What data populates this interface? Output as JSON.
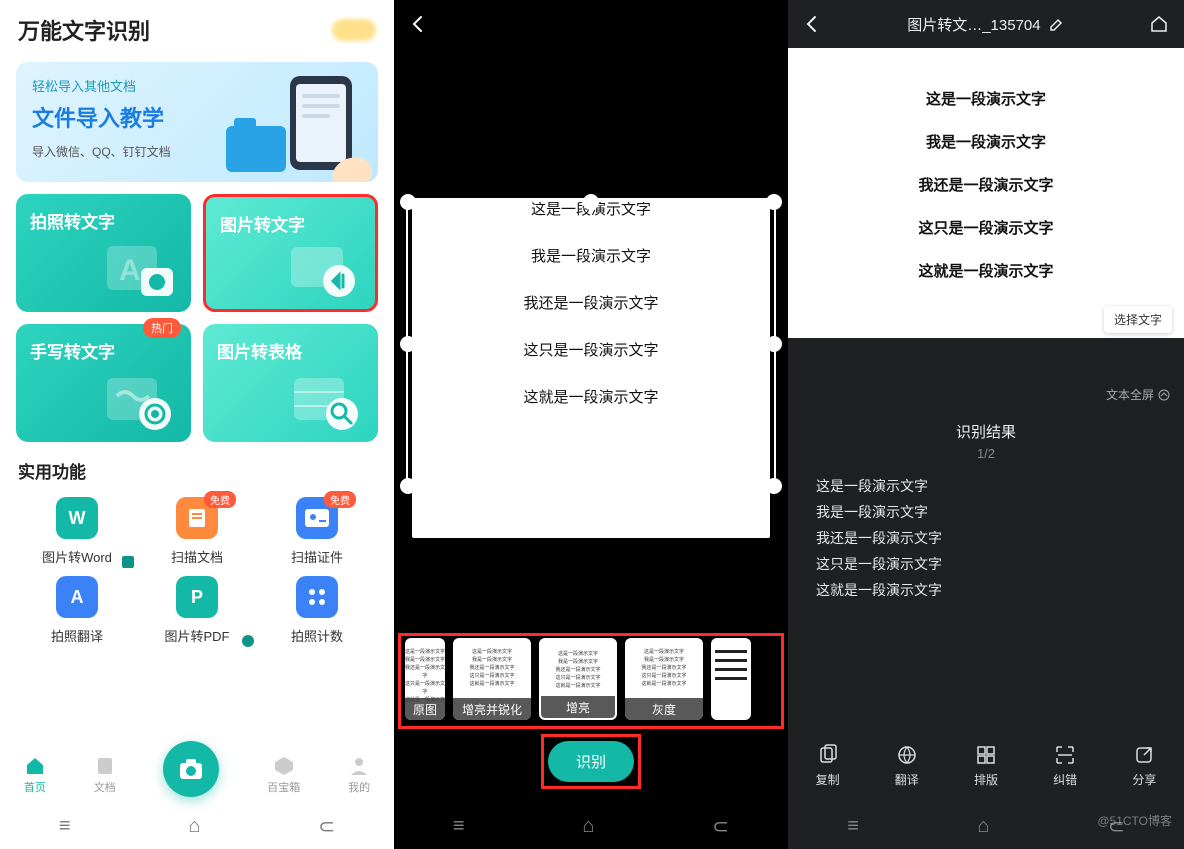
{
  "panel1": {
    "title": "万能文字识别",
    "banner": {
      "sub1": "轻松导入其他文档",
      "main": "文件导入教学",
      "sub2": "导入微信、QQ、钉钉文档"
    },
    "cards": [
      {
        "label": "拍照转文字"
      },
      {
        "label": "图片转文字"
      },
      {
        "label": "手写转文字",
        "hot": "热门"
      },
      {
        "label": "图片转表格"
      }
    ],
    "section_title": "实用功能",
    "tools": [
      {
        "label": "图片转Word",
        "color": "#14b8a6",
        "letter": "W",
        "free": ""
      },
      {
        "label": "扫描文档",
        "color": "#ff8a3d",
        "letter": "",
        "free": "免费"
      },
      {
        "label": "扫描证件",
        "color": "#3b82f6",
        "letter": "",
        "free": "免费"
      },
      {
        "label": "拍照翻译",
        "color": "#3b82f6",
        "letter": "A",
        "free": ""
      },
      {
        "label": "图片转PDF",
        "color": "#14b8a6",
        "letter": "P",
        "free": ""
      },
      {
        "label": "拍照计数",
        "color": "#3b82f6",
        "letter": "",
        "free": ""
      }
    ],
    "nav": {
      "home": "首页",
      "docs": "文档",
      "box": "百宝箱",
      "me": "我的"
    }
  },
  "panel2": {
    "page_lines": [
      "这是一段演示文字",
      "我是一段演示文字",
      "我还是一段演示文字",
      "这只是一段演示文字",
      "这就是一段演示文字"
    ],
    "filters": [
      "原图",
      "增亮并锐化",
      "增亮",
      "灰度"
    ],
    "recognize": "识别"
  },
  "panel3": {
    "title": "图片转文…_135704",
    "doc_lines": [
      "这是一段演示文字",
      "我是一段演示文字",
      "我还是一段演示文字",
      "这只是一段演示文字",
      "这就是一段演示文字"
    ],
    "select_text": "选择文字",
    "fullscreen": "文本全屏",
    "result_title": "识别结果",
    "result_count": "1/2",
    "result_lines": [
      "这是一段演示文字",
      "我是一段演示文字",
      "我还是一段演示文字",
      "这只是一段演示文字",
      "这就是一段演示文字"
    ],
    "actions": {
      "copy": "复制",
      "translate": "翻译",
      "layout": "排版",
      "correct": "纠错",
      "share": "分享"
    }
  },
  "watermark": "@51CTO博客"
}
